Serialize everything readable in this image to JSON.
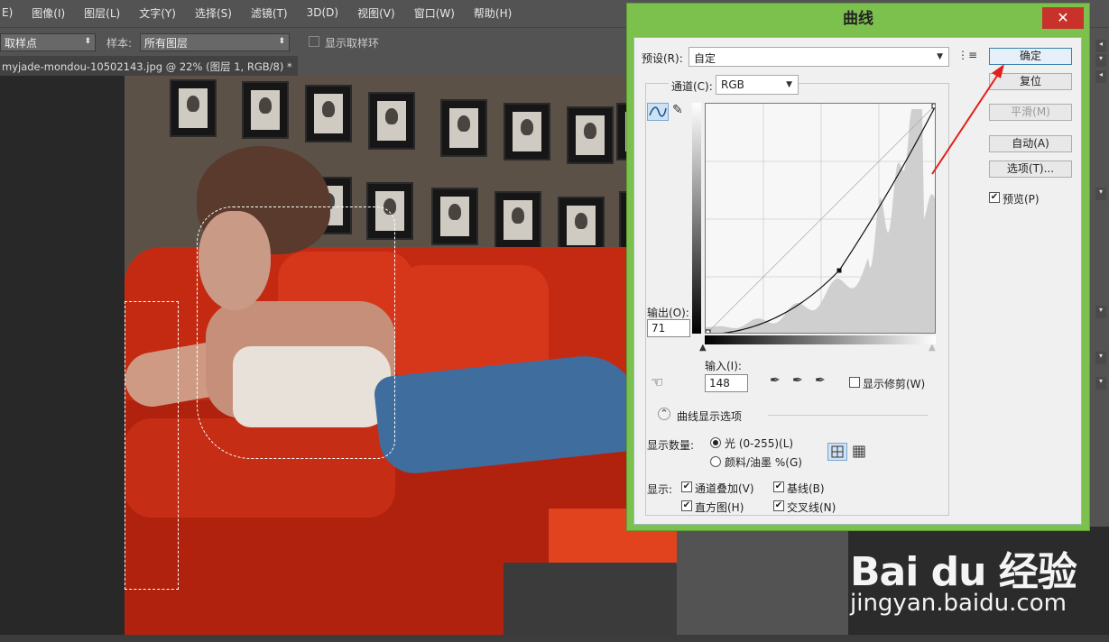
{
  "menubar": {
    "items": [
      "E)",
      "图像(I)",
      "图层(L)",
      "文字(Y)",
      "选择(S)",
      "滤镜(T)",
      "3D(D)",
      "视图(V)",
      "窗口(W)",
      "帮助(H)"
    ]
  },
  "options": {
    "tool_select": "取样点",
    "sample_label": "样本:",
    "sample_value": "所有图层",
    "show_ring": "显示取样环"
  },
  "document": {
    "tab_title": "myjade-mondou-10502143.jpg @ 22% (图层 1, RGB/8) *",
    "close": "×"
  },
  "dialog": {
    "title": "曲线",
    "close": "✕",
    "preset_label": "预设(R):",
    "preset_value": "自定",
    "channel_label": "通道(C):",
    "channel_value": "RGB",
    "buttons": {
      "ok": "确定",
      "reset": "复位",
      "smooth": "平滑(M)",
      "auto": "自动(A)",
      "options": "选项(T)..."
    },
    "preview_label": "预览(P)",
    "output_label": "输出(O):",
    "output_value": "71",
    "input_label": "输入(I):",
    "input_value": "148",
    "show_clipping": "显示修剪(W)",
    "curve_display_options": "曲线显示选项",
    "show_amount_label": "显示数量:",
    "light_label": "光 (0-255)(L)",
    "pigment_label": "颜料/油墨 %(G)",
    "show_label": "显示:",
    "channel_overlay": "通道叠加(V)",
    "baseline": "基线(B)",
    "histogram": "直方图(H)",
    "intersection": "交叉线(N)"
  },
  "curve": {
    "control_point": {
      "input": 148,
      "output": 71
    },
    "endpoints": [
      [
        0,
        0
      ],
      [
        255,
        255
      ]
    ]
  },
  "watermark": {
    "brand": "Bai du 经验",
    "url": "jingyan.baidu.com"
  },
  "colors": {
    "dialog_frame": "#7cc04e",
    "close_button": "#c8322b",
    "annotation_arrow": "#e0201c"
  }
}
